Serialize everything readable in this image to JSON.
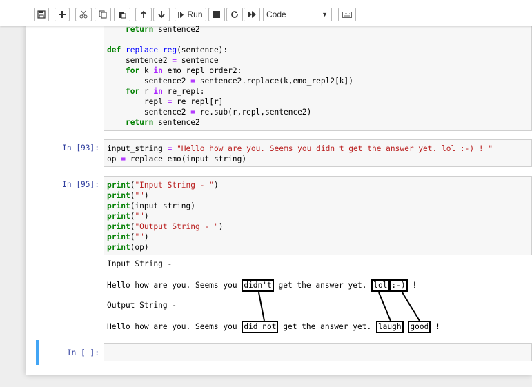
{
  "toolbar": {
    "run_label": "Run",
    "cell_type": "Code",
    "buttons": [
      "save-icon",
      "plus-icon",
      "cut-icon",
      "copy-icon",
      "paste-icon",
      "arrow-up-icon",
      "arrow-down-icon",
      "run-icon",
      "stop-icon",
      "restart-icon",
      "fast-forward-icon",
      "keyboard-icon"
    ]
  },
  "cells": [
    {
      "prompt": "",
      "code_lines": [
        "    return sentence2",
        "",
        "def replace_reg(sentence):",
        "    sentence2 = sentence",
        "    for k in emo_repl_order2:",
        "        sentence2 = sentence2.replace(k,emo_repl2[k])",
        "    for r in re_repl:",
        "        repl = re_repl[r]",
        "        sentence2 = re.sub(r,repl,sentence2)",
        "    return sentence2"
      ]
    },
    {
      "prompt": "In [93]:",
      "code_lines": [
        "input_string = \"Hello how are you. Seems you didn't get the answer yet. lol :-) ! \"",
        "op = replace_emo(input_string)"
      ]
    },
    {
      "prompt": "In [95]:",
      "code_lines": [
        "print(\"Input String - \")",
        "print(\"\")",
        "print(input_string)",
        "print(\"\")",
        "print(\"Output String - \")",
        "print(\"\")",
        "print(op)"
      ],
      "output": {
        "line1": "Input String -",
        "line2_prefix": "Hello how are you. Seems you ",
        "line2_box1": "didn't",
        "line2_mid": " get the answer yet. ",
        "line2_box2": "lol",
        "line2_box3": ":-)",
        "line2_suffix": " !",
        "line3": "Output String -",
        "line4_prefix": "Hello how are you. Seems you ",
        "line4_box1": "did not",
        "line4_mid": " get the answer yet. ",
        "line4_box2": "laugh",
        "line4_box3": "good",
        "line4_suffix": " !"
      }
    },
    {
      "prompt": "In [ ]:",
      "code_lines": []
    }
  ]
}
